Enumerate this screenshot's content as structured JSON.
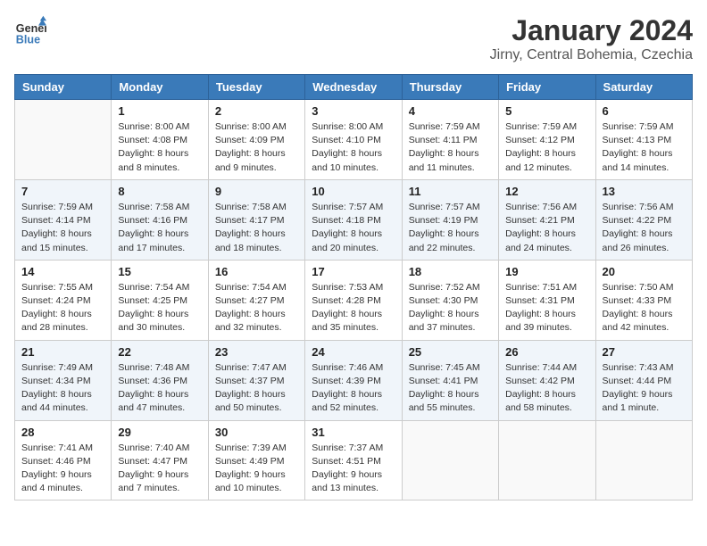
{
  "header": {
    "logo_line1": "General",
    "logo_line2": "Blue",
    "title": "January 2024",
    "subtitle": "Jirny, Central Bohemia, Czechia"
  },
  "weekdays": [
    "Sunday",
    "Monday",
    "Tuesday",
    "Wednesday",
    "Thursday",
    "Friday",
    "Saturday"
  ],
  "weeks": [
    [
      {
        "day": "",
        "sunrise": "",
        "sunset": "",
        "daylight": ""
      },
      {
        "day": "1",
        "sunrise": "Sunrise: 8:00 AM",
        "sunset": "Sunset: 4:08 PM",
        "daylight": "Daylight: 8 hours and 8 minutes."
      },
      {
        "day": "2",
        "sunrise": "Sunrise: 8:00 AM",
        "sunset": "Sunset: 4:09 PM",
        "daylight": "Daylight: 8 hours and 9 minutes."
      },
      {
        "day": "3",
        "sunrise": "Sunrise: 8:00 AM",
        "sunset": "Sunset: 4:10 PM",
        "daylight": "Daylight: 8 hours and 10 minutes."
      },
      {
        "day": "4",
        "sunrise": "Sunrise: 7:59 AM",
        "sunset": "Sunset: 4:11 PM",
        "daylight": "Daylight: 8 hours and 11 minutes."
      },
      {
        "day": "5",
        "sunrise": "Sunrise: 7:59 AM",
        "sunset": "Sunset: 4:12 PM",
        "daylight": "Daylight: 8 hours and 12 minutes."
      },
      {
        "day": "6",
        "sunrise": "Sunrise: 7:59 AM",
        "sunset": "Sunset: 4:13 PM",
        "daylight": "Daylight: 8 hours and 14 minutes."
      }
    ],
    [
      {
        "day": "7",
        "sunrise": "Sunrise: 7:59 AM",
        "sunset": "Sunset: 4:14 PM",
        "daylight": "Daylight: 8 hours and 15 minutes."
      },
      {
        "day": "8",
        "sunrise": "Sunrise: 7:58 AM",
        "sunset": "Sunset: 4:16 PM",
        "daylight": "Daylight: 8 hours and 17 minutes."
      },
      {
        "day": "9",
        "sunrise": "Sunrise: 7:58 AM",
        "sunset": "Sunset: 4:17 PM",
        "daylight": "Daylight: 8 hours and 18 minutes."
      },
      {
        "day": "10",
        "sunrise": "Sunrise: 7:57 AM",
        "sunset": "Sunset: 4:18 PM",
        "daylight": "Daylight: 8 hours and 20 minutes."
      },
      {
        "day": "11",
        "sunrise": "Sunrise: 7:57 AM",
        "sunset": "Sunset: 4:19 PM",
        "daylight": "Daylight: 8 hours and 22 minutes."
      },
      {
        "day": "12",
        "sunrise": "Sunrise: 7:56 AM",
        "sunset": "Sunset: 4:21 PM",
        "daylight": "Daylight: 8 hours and 24 minutes."
      },
      {
        "day": "13",
        "sunrise": "Sunrise: 7:56 AM",
        "sunset": "Sunset: 4:22 PM",
        "daylight": "Daylight: 8 hours and 26 minutes."
      }
    ],
    [
      {
        "day": "14",
        "sunrise": "Sunrise: 7:55 AM",
        "sunset": "Sunset: 4:24 PM",
        "daylight": "Daylight: 8 hours and 28 minutes."
      },
      {
        "day": "15",
        "sunrise": "Sunrise: 7:54 AM",
        "sunset": "Sunset: 4:25 PM",
        "daylight": "Daylight: 8 hours and 30 minutes."
      },
      {
        "day": "16",
        "sunrise": "Sunrise: 7:54 AM",
        "sunset": "Sunset: 4:27 PM",
        "daylight": "Daylight: 8 hours and 32 minutes."
      },
      {
        "day": "17",
        "sunrise": "Sunrise: 7:53 AM",
        "sunset": "Sunset: 4:28 PM",
        "daylight": "Daylight: 8 hours and 35 minutes."
      },
      {
        "day": "18",
        "sunrise": "Sunrise: 7:52 AM",
        "sunset": "Sunset: 4:30 PM",
        "daylight": "Daylight: 8 hours and 37 minutes."
      },
      {
        "day": "19",
        "sunrise": "Sunrise: 7:51 AM",
        "sunset": "Sunset: 4:31 PM",
        "daylight": "Daylight: 8 hours and 39 minutes."
      },
      {
        "day": "20",
        "sunrise": "Sunrise: 7:50 AM",
        "sunset": "Sunset: 4:33 PM",
        "daylight": "Daylight: 8 hours and 42 minutes."
      }
    ],
    [
      {
        "day": "21",
        "sunrise": "Sunrise: 7:49 AM",
        "sunset": "Sunset: 4:34 PM",
        "daylight": "Daylight: 8 hours and 44 minutes."
      },
      {
        "day": "22",
        "sunrise": "Sunrise: 7:48 AM",
        "sunset": "Sunset: 4:36 PM",
        "daylight": "Daylight: 8 hours and 47 minutes."
      },
      {
        "day": "23",
        "sunrise": "Sunrise: 7:47 AM",
        "sunset": "Sunset: 4:37 PM",
        "daylight": "Daylight: 8 hours and 50 minutes."
      },
      {
        "day": "24",
        "sunrise": "Sunrise: 7:46 AM",
        "sunset": "Sunset: 4:39 PM",
        "daylight": "Daylight: 8 hours and 52 minutes."
      },
      {
        "day": "25",
        "sunrise": "Sunrise: 7:45 AM",
        "sunset": "Sunset: 4:41 PM",
        "daylight": "Daylight: 8 hours and 55 minutes."
      },
      {
        "day": "26",
        "sunrise": "Sunrise: 7:44 AM",
        "sunset": "Sunset: 4:42 PM",
        "daylight": "Daylight: 8 hours and 58 minutes."
      },
      {
        "day": "27",
        "sunrise": "Sunrise: 7:43 AM",
        "sunset": "Sunset: 4:44 PM",
        "daylight": "Daylight: 9 hours and 1 minute."
      }
    ],
    [
      {
        "day": "28",
        "sunrise": "Sunrise: 7:41 AM",
        "sunset": "Sunset: 4:46 PM",
        "daylight": "Daylight: 9 hours and 4 minutes."
      },
      {
        "day": "29",
        "sunrise": "Sunrise: 7:40 AM",
        "sunset": "Sunset: 4:47 PM",
        "daylight": "Daylight: 9 hours and 7 minutes."
      },
      {
        "day": "30",
        "sunrise": "Sunrise: 7:39 AM",
        "sunset": "Sunset: 4:49 PM",
        "daylight": "Daylight: 9 hours and 10 minutes."
      },
      {
        "day": "31",
        "sunrise": "Sunrise: 7:37 AM",
        "sunset": "Sunset: 4:51 PM",
        "daylight": "Daylight: 9 hours and 13 minutes."
      },
      {
        "day": "",
        "sunrise": "",
        "sunset": "",
        "daylight": ""
      },
      {
        "day": "",
        "sunrise": "",
        "sunset": "",
        "daylight": ""
      },
      {
        "day": "",
        "sunrise": "",
        "sunset": "",
        "daylight": ""
      }
    ]
  ]
}
